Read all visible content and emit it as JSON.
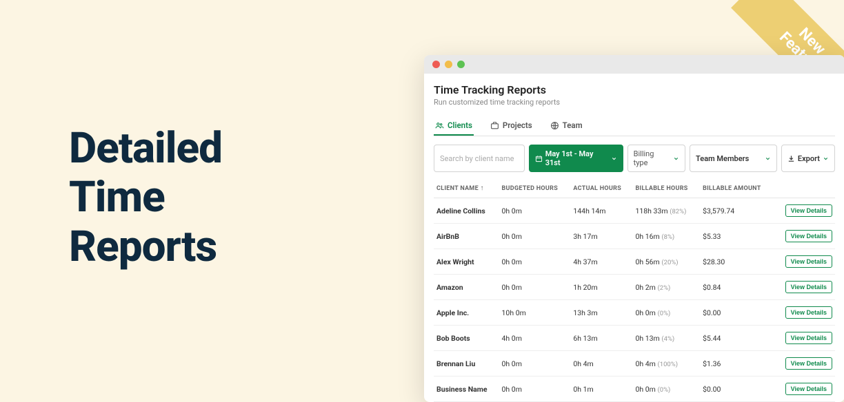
{
  "hero": "Detailed\nTime\nReports",
  "ribbon": "New\nFeature",
  "window": {
    "title": "Time Tracking Reports",
    "subtitle": "Run customized time tracking reports"
  },
  "tabs": [
    {
      "label": "Clients",
      "active": true
    },
    {
      "label": "Projects",
      "active": false
    },
    {
      "label": "Team",
      "active": false
    }
  ],
  "filters": {
    "search_placeholder": "Search by client name",
    "date_range": "May 1st - May 31st",
    "billing_label": "Billing type",
    "team_label": "Team Members",
    "export_label": "Export"
  },
  "columns": {
    "client": "CLIENT NAME",
    "budgeted": "BUDGETED HOURS",
    "actual": "ACTUAL HOURS",
    "billable": "BILLABLE HOURS",
    "amount": "BILLABLE AMOUNT",
    "action": "View Details"
  },
  "rows": [
    {
      "client": "Adeline Collins",
      "budgeted": "0h 0m",
      "actual": "144h 14m",
      "over": false,
      "billable": "118h 33m",
      "pct": "(82%)",
      "amount": "$3,579.74"
    },
    {
      "client": "AirBnB",
      "budgeted": "0h 0m",
      "actual": "3h 17m",
      "over": false,
      "billable": "0h 16m",
      "pct": "(8%)",
      "amount": "$5.33"
    },
    {
      "client": "Alex Wright",
      "budgeted": "0h 0m",
      "actual": "4h 37m",
      "over": false,
      "billable": "0h 56m",
      "pct": "(20%)",
      "amount": "$28.30"
    },
    {
      "client": "Amazon",
      "budgeted": "0h 0m",
      "actual": "1h 20m",
      "over": false,
      "billable": "0h 2m",
      "pct": "(2%)",
      "amount": "$0.84"
    },
    {
      "client": "Apple Inc.",
      "budgeted": "10h 0m",
      "actual": "13h 3m",
      "over": true,
      "billable": "0h 0m",
      "pct": "(0%)",
      "amount": "$0.00"
    },
    {
      "client": "Bob Boots",
      "budgeted": "4h 0m",
      "actual": "6h 13m",
      "over": true,
      "billable": "0h 13m",
      "pct": "(4%)",
      "amount": "$5.44"
    },
    {
      "client": "Brennan Liu",
      "budgeted": "0h 0m",
      "actual": "0h 4m",
      "over": false,
      "billable": "0h 4m",
      "pct": "(100%)",
      "amount": "$1.36"
    },
    {
      "client": "Business Name",
      "budgeted": "0h 0m",
      "actual": "0h 1m",
      "over": false,
      "billable": "0h 0m",
      "pct": "(0%)",
      "amount": "$0.00"
    }
  ],
  "colors": {
    "accent": "#0f8a4c",
    "danger": "#d9403a"
  }
}
